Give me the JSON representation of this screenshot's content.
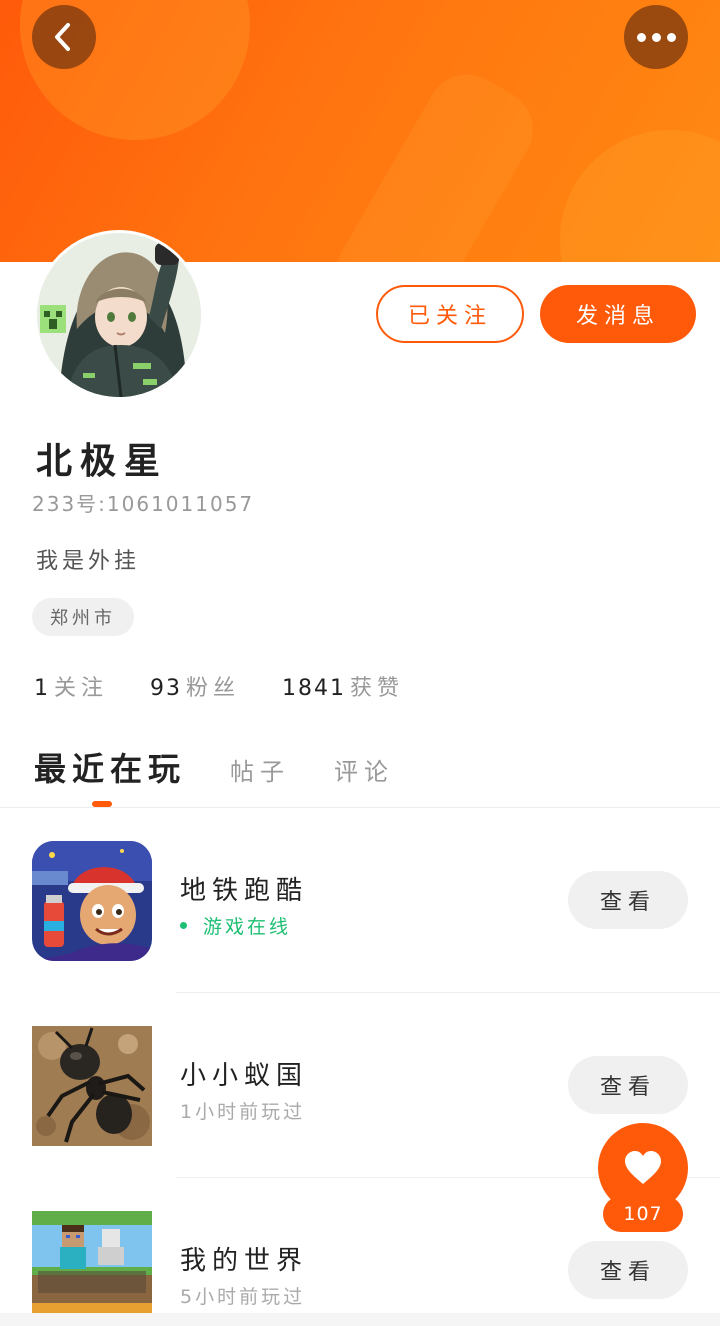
{
  "header": {
    "back_icon": "chevron-left-icon",
    "more_icon": "more-dots-icon",
    "colors": {
      "accent": "#ff5a0a",
      "banner_end": "#ff8a12"
    }
  },
  "profile": {
    "avatar_icon": "anime-avatar",
    "follow_label": "已关注",
    "message_label": "发消息",
    "username": "北极星",
    "user_id": "233号:1061011057",
    "bio": "我是外挂",
    "location": "郑州市"
  },
  "stats": [
    {
      "value": "1",
      "label": "关注"
    },
    {
      "value": "93",
      "label": "粉丝"
    },
    {
      "value": "1841",
      "label": "获赞"
    }
  ],
  "tabs": [
    {
      "label": "最近在玩",
      "active": true
    },
    {
      "label": "帖子",
      "active": false
    },
    {
      "label": "评论",
      "active": false
    }
  ],
  "games": [
    {
      "name": "地铁跑酷",
      "status": "游戏在线",
      "online": true,
      "view_label": "查看",
      "icon": "subway-surfers-icon"
    },
    {
      "name": "小小蚁国",
      "status": "1小时前玩过",
      "online": false,
      "view_label": "查看",
      "icon": "ant-kingdom-icon"
    },
    {
      "name": "我的世界",
      "status": "5小时前玩过",
      "online": false,
      "view_label": "查看",
      "icon": "minecraft-icon"
    }
  ],
  "like": {
    "icon": "heart-icon",
    "count": "107"
  }
}
